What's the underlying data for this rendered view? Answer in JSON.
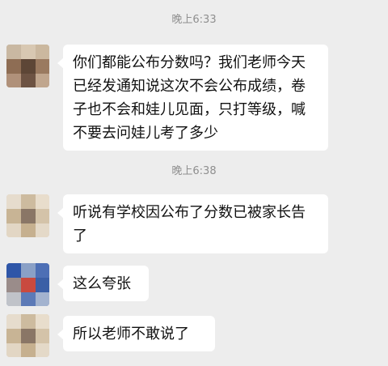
{
  "messages": [
    {
      "type": "time",
      "text": "晚上6:33"
    },
    {
      "type": "msg",
      "sender": "contact-a",
      "text": "你们都能公布分数吗？我们老师今天已经发通知说这次不会公布成绩，卷子也不会和娃儿见面，只打等级，喊不要去问娃儿考了多少"
    },
    {
      "type": "time",
      "text": "晚上6:38"
    },
    {
      "type": "msg",
      "sender": "contact-b",
      "text": "听说有学校因公布了分数已被家长告了"
    },
    {
      "type": "msg",
      "sender": "contact-c",
      "text": "这么夸张"
    },
    {
      "type": "msg",
      "sender": "contact-b",
      "text": "所以老师不敢说了"
    }
  ],
  "colors": {
    "background": "#ededed",
    "bubble": "#ffffff",
    "timestamp": "#8f8f8f",
    "text": "#111111"
  }
}
